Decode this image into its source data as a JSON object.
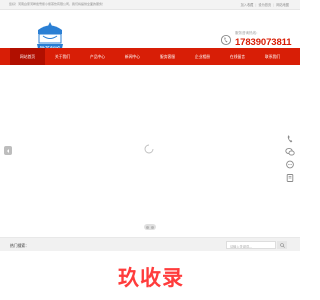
{
  "topbar": {
    "welcome": "您好！河南白家河畔蜜雪熊小熊茶饮有限公司，我们将提供全面的服务！",
    "links": [
      "加入收藏",
      "设为首页",
      "网站地图"
    ]
  },
  "header": {
    "logo_text": "锄茶鲜饮",
    "phone_caption": "服务咨询热线：",
    "phone_number": "17839073811"
  },
  "nav": {
    "items": [
      {
        "label": "网站首页",
        "active": true
      },
      {
        "label": "关于我们",
        "active": false
      },
      {
        "label": "产品中心",
        "active": false
      },
      {
        "label": "新闻中心",
        "active": false
      },
      {
        "label": "服务客服",
        "active": false
      },
      {
        "label": "企业相册",
        "active": false
      },
      {
        "label": "在线留言",
        "active": false
      },
      {
        "label": "联系我们",
        "active": false
      }
    ]
  },
  "hotbar": {
    "label": "热门搜索：",
    "search_placeholder": "请输入关键词..."
  },
  "watermark": "玖收录",
  "colors": {
    "brand_red": "#d81e06",
    "nav_active": "#b10f00",
    "logo_blue": "#2a7fd4"
  },
  "icons": {
    "phone": "phone-icon",
    "loader": "spinner-icon",
    "slider_prev": "arrow-left-icon",
    "side_phone": "phone-icon",
    "side_wechat": "wechat-icon",
    "side_chat": "chat-icon",
    "side_top": "back-to-top-icon",
    "search": "search-icon"
  }
}
